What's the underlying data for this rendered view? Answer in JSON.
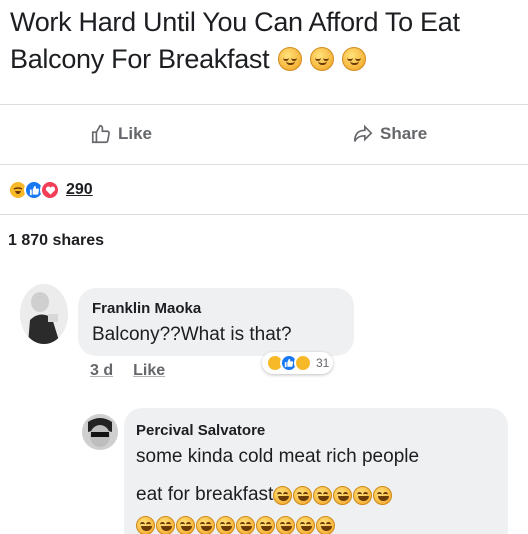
{
  "post": {
    "text": "Work Hard Until You Can Afford To Eat Balcony For Breakfast",
    "emoji_icons": [
      "relieved-face-icon",
      "relieved-face-icon",
      "relieved-face-icon"
    ]
  },
  "actions": {
    "like_label": "Like",
    "share_label": "Share"
  },
  "reactions": {
    "icons": [
      "haha-icon",
      "like-icon",
      "love-icon"
    ],
    "count": "290"
  },
  "shares": {
    "text": "1 870 shares"
  },
  "comments": [
    {
      "author": "Franklin Maoka",
      "text": "Balcony??What is that?",
      "time": "3 d",
      "like_label": "Like",
      "reaction_icons": [
        "haha-icon",
        "like-icon",
        "wow-icon"
      ],
      "reaction_count": "31"
    },
    {
      "author": "Percival Salvatore",
      "text_line1": "some kinda cold meat rich people",
      "text_line2": "eat for breakfast",
      "emoji_icon": "tears-of-joy-icon",
      "emoji_count_line1": 6,
      "emoji_count_line2": 10
    }
  ],
  "colors": {
    "text": "#1c1e21",
    "secondary": "#65676b",
    "divider": "#dadde1",
    "bubble": "#eef0f2",
    "like_blue": "#1877f2"
  }
}
